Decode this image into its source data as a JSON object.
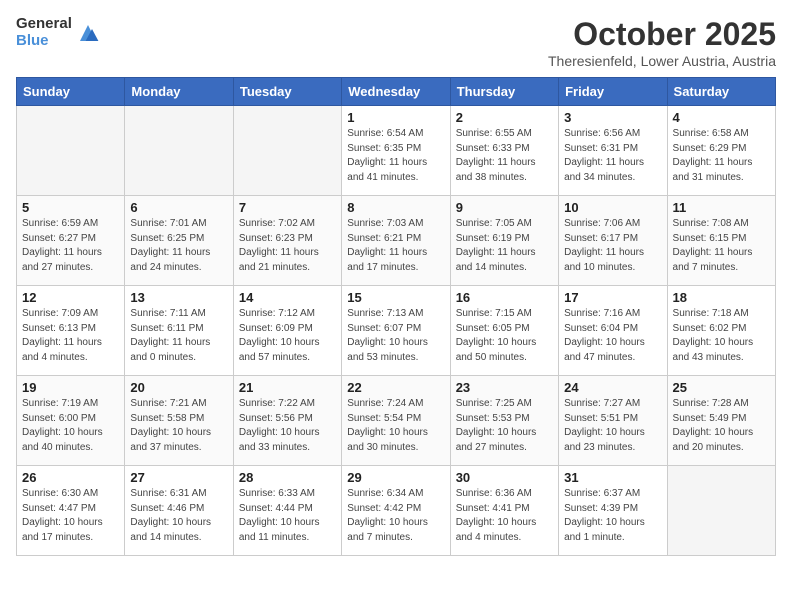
{
  "logo": {
    "general": "General",
    "blue": "Blue"
  },
  "header": {
    "month": "October 2025",
    "location": "Theresienfeld, Lower Austria, Austria"
  },
  "weekdays": [
    "Sunday",
    "Monday",
    "Tuesday",
    "Wednesday",
    "Thursday",
    "Friday",
    "Saturday"
  ],
  "weeks": [
    [
      {
        "day": "",
        "info": ""
      },
      {
        "day": "",
        "info": ""
      },
      {
        "day": "",
        "info": ""
      },
      {
        "day": "1",
        "info": "Sunrise: 6:54 AM\nSunset: 6:35 PM\nDaylight: 11 hours\nand 41 minutes."
      },
      {
        "day": "2",
        "info": "Sunrise: 6:55 AM\nSunset: 6:33 PM\nDaylight: 11 hours\nand 38 minutes."
      },
      {
        "day": "3",
        "info": "Sunrise: 6:56 AM\nSunset: 6:31 PM\nDaylight: 11 hours\nand 34 minutes."
      },
      {
        "day": "4",
        "info": "Sunrise: 6:58 AM\nSunset: 6:29 PM\nDaylight: 11 hours\nand 31 minutes."
      }
    ],
    [
      {
        "day": "5",
        "info": "Sunrise: 6:59 AM\nSunset: 6:27 PM\nDaylight: 11 hours\nand 27 minutes."
      },
      {
        "day": "6",
        "info": "Sunrise: 7:01 AM\nSunset: 6:25 PM\nDaylight: 11 hours\nand 24 minutes."
      },
      {
        "day": "7",
        "info": "Sunrise: 7:02 AM\nSunset: 6:23 PM\nDaylight: 11 hours\nand 21 minutes."
      },
      {
        "day": "8",
        "info": "Sunrise: 7:03 AM\nSunset: 6:21 PM\nDaylight: 11 hours\nand 17 minutes."
      },
      {
        "day": "9",
        "info": "Sunrise: 7:05 AM\nSunset: 6:19 PM\nDaylight: 11 hours\nand 14 minutes."
      },
      {
        "day": "10",
        "info": "Sunrise: 7:06 AM\nSunset: 6:17 PM\nDaylight: 11 hours\nand 10 minutes."
      },
      {
        "day": "11",
        "info": "Sunrise: 7:08 AM\nSunset: 6:15 PM\nDaylight: 11 hours\nand 7 minutes."
      }
    ],
    [
      {
        "day": "12",
        "info": "Sunrise: 7:09 AM\nSunset: 6:13 PM\nDaylight: 11 hours\nand 4 minutes."
      },
      {
        "day": "13",
        "info": "Sunrise: 7:11 AM\nSunset: 6:11 PM\nDaylight: 11 hours\nand 0 minutes."
      },
      {
        "day": "14",
        "info": "Sunrise: 7:12 AM\nSunset: 6:09 PM\nDaylight: 10 hours\nand 57 minutes."
      },
      {
        "day": "15",
        "info": "Sunrise: 7:13 AM\nSunset: 6:07 PM\nDaylight: 10 hours\nand 53 minutes."
      },
      {
        "day": "16",
        "info": "Sunrise: 7:15 AM\nSunset: 6:05 PM\nDaylight: 10 hours\nand 50 minutes."
      },
      {
        "day": "17",
        "info": "Sunrise: 7:16 AM\nSunset: 6:04 PM\nDaylight: 10 hours\nand 47 minutes."
      },
      {
        "day": "18",
        "info": "Sunrise: 7:18 AM\nSunset: 6:02 PM\nDaylight: 10 hours\nand 43 minutes."
      }
    ],
    [
      {
        "day": "19",
        "info": "Sunrise: 7:19 AM\nSunset: 6:00 PM\nDaylight: 10 hours\nand 40 minutes."
      },
      {
        "day": "20",
        "info": "Sunrise: 7:21 AM\nSunset: 5:58 PM\nDaylight: 10 hours\nand 37 minutes."
      },
      {
        "day": "21",
        "info": "Sunrise: 7:22 AM\nSunset: 5:56 PM\nDaylight: 10 hours\nand 33 minutes."
      },
      {
        "day": "22",
        "info": "Sunrise: 7:24 AM\nSunset: 5:54 PM\nDaylight: 10 hours\nand 30 minutes."
      },
      {
        "day": "23",
        "info": "Sunrise: 7:25 AM\nSunset: 5:53 PM\nDaylight: 10 hours\nand 27 minutes."
      },
      {
        "day": "24",
        "info": "Sunrise: 7:27 AM\nSunset: 5:51 PM\nDaylight: 10 hours\nand 23 minutes."
      },
      {
        "day": "25",
        "info": "Sunrise: 7:28 AM\nSunset: 5:49 PM\nDaylight: 10 hours\nand 20 minutes."
      }
    ],
    [
      {
        "day": "26",
        "info": "Sunrise: 6:30 AM\nSunset: 4:47 PM\nDaylight: 10 hours\nand 17 minutes."
      },
      {
        "day": "27",
        "info": "Sunrise: 6:31 AM\nSunset: 4:46 PM\nDaylight: 10 hours\nand 14 minutes."
      },
      {
        "day": "28",
        "info": "Sunrise: 6:33 AM\nSunset: 4:44 PM\nDaylight: 10 hours\nand 11 minutes."
      },
      {
        "day": "29",
        "info": "Sunrise: 6:34 AM\nSunset: 4:42 PM\nDaylight: 10 hours\nand 7 minutes."
      },
      {
        "day": "30",
        "info": "Sunrise: 6:36 AM\nSunset: 4:41 PM\nDaylight: 10 hours\nand 4 minutes."
      },
      {
        "day": "31",
        "info": "Sunrise: 6:37 AM\nSunset: 4:39 PM\nDaylight: 10 hours\nand 1 minute."
      },
      {
        "day": "",
        "info": ""
      }
    ]
  ]
}
